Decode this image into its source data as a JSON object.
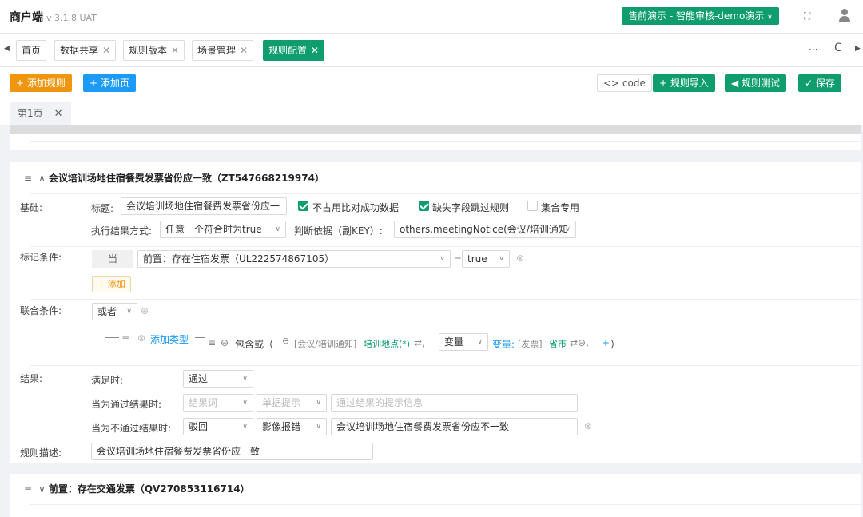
{
  "header": {
    "app_title": "商户端",
    "version": "v 3.1.8 UAT",
    "env_selector": "售前演示 - 智能审核-demo演示",
    "fullscreen_icon": "fullscreen-icon",
    "user_icon": "user-icon"
  },
  "tabs": [
    {
      "label": "首页",
      "closable": false
    },
    {
      "label": "数据共享",
      "closable": true
    },
    {
      "label": "规则版本",
      "closable": true
    },
    {
      "label": "场景管理",
      "closable": true
    },
    {
      "label": "规则配置",
      "closable": true,
      "active": true
    }
  ],
  "tabbar": {
    "more": "···",
    "refresh": "C"
  },
  "toolbar": {
    "add_rule": "+ 添加规则",
    "add_page": "+ 添加页",
    "code": "<> code",
    "import_rules": "+ 规则导入",
    "test_rules": "◀ 规则测试",
    "save": "✓ 保存"
  },
  "page_tab": {
    "label": "第1页",
    "close": "✕"
  },
  "rule": {
    "drag": "≡",
    "caret": "∧",
    "title": "会议培训场地住宿餐费发票省份应一致（ZT547668219974）",
    "basic": {
      "section_label": "基础:",
      "title_label": "标题:",
      "title_value": "会议培训场地住宿餐费发票省份应一",
      "opt1": "不占用比对成功数据",
      "opt1_checked": true,
      "opt2": "缺失字段跳过规则",
      "opt2_checked": true,
      "opt3": "集合专用",
      "opt3_checked": false,
      "exec_label": "执行结果方式:",
      "exec_value": "任意一个符合时为true",
      "basis_label": "判断依据（副KEY）:",
      "basis_value": "others.meetingNotice(会议/培训通知"
    },
    "mark": {
      "section_label": "标记条件:",
      "when": "当",
      "cond_value": "前置：存在住宿发票（UL222574867105）",
      "eq": "=",
      "bool_value": "true",
      "add": "+ 添加"
    },
    "union": {
      "section_label": "联合条件:",
      "op": "或者",
      "add_type": "添加类型",
      "contains": "包含或（",
      "src_tag": "[会议/培训通知]",
      "src_field": "培训地点(*)",
      "var_select": "变量",
      "var_label": "变量:",
      "var_tag": "[发票]",
      "var_field": "省市",
      "plus": "+",
      "close_paren": "）"
    },
    "result": {
      "section_label": "结果:",
      "satisfied_label": "满足时:",
      "satisfied_value": "通过",
      "pass_label": "当为通过结果时:",
      "pass_word_ph": "结果词",
      "pass_hint_ph": "单据提示",
      "pass_msg_ph": "通过结果的提示信息",
      "fail_label": "当为不通过结果时:",
      "fail_word": "驳回",
      "fail_hint": "影像报错",
      "fail_msg": "会议培训场地住宿餐费发票省份应不一致"
    },
    "desc": {
      "section_label": "规则描述:",
      "value": "会议培训场地住宿餐费发票省份应一致"
    }
  },
  "rule2": {
    "drag": "≡",
    "caret": "∨",
    "title": "前置：存在交通发票（QV270853116714）"
  }
}
